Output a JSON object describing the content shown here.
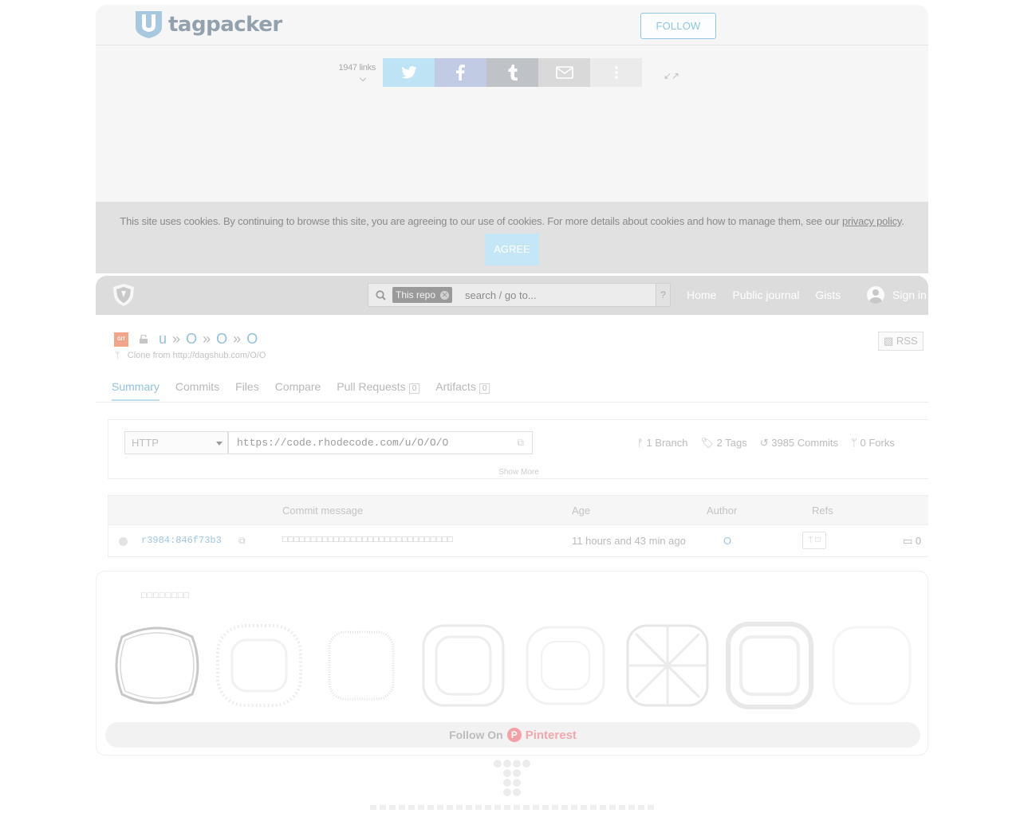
{
  "tagpacker": {
    "logo_text": "tagpacker",
    "follow_label": "FOLLOW",
    "link_count": "1947 links",
    "share_buttons": [
      {
        "icon": "twitter-icon",
        "color": "#bde3f5"
      },
      {
        "icon": "facebook-icon",
        "color": "#c1cbe3"
      },
      {
        "icon": "tumblr-icon",
        "color": "#bfc3c8"
      },
      {
        "icon": "mail-icon",
        "color": "#d9d9d9"
      },
      {
        "icon": "more-icon",
        "color": "#ebebeb"
      }
    ],
    "cookie_text": "This site uses cookies. By continuing to browse this site, you are agreeing to our use of cookies. For more details about cookies and how to manage them, see our ",
    "cookie_link": "privacy policy",
    "cookie_end": ".",
    "agree_label": "AGREE"
  },
  "rhodecode": {
    "search_scope": "This repo",
    "search_placeholder": "search / go to...",
    "search_help": "?",
    "nav": [
      "Home",
      "Public journal",
      "Gists"
    ],
    "sign_in": "Sign in",
    "breadcrumb": [
      "u",
      "O",
      "O",
      "O"
    ],
    "breadcrumb_sep": "»",
    "git_badge": "GIT",
    "clone_from": "Clone from http://dagshub.com/O/O",
    "rss": "RSS",
    "tabs": [
      {
        "label": "Summary",
        "count": null
      },
      {
        "label": "Commits",
        "count": null
      },
      {
        "label": "Files",
        "count": null
      },
      {
        "label": "Compare",
        "count": null
      },
      {
        "label": "Pull Requests",
        "count": "0"
      },
      {
        "label": "Artifacts",
        "count": "0"
      }
    ],
    "protocol": "HTTP",
    "clone_url": "https://code.rhodecode.com/u/O/O/O",
    "stats": {
      "branches": "1 Branch",
      "tags": "2 Tags",
      "commits": "3985 Commits",
      "forks": "0 Forks"
    },
    "show_more": "Show More",
    "table_headers": {
      "message": "Commit message",
      "age": "Age",
      "author": "Author",
      "refs": "Refs"
    },
    "commits": [
      {
        "hash": "r3984:846f73b3",
        "message": "□□□□□□□□□□□□□□□□□□□□□□□□□□□□□□",
        "age": "11 hours and 43 min ago",
        "author": "O",
        "ref": "ᛘ □",
        "comments": "0"
      }
    ]
  },
  "pinterest": {
    "title": "□□□□□□□□",
    "follow_prefix": "Follow On",
    "brand": "Pinterest"
  }
}
